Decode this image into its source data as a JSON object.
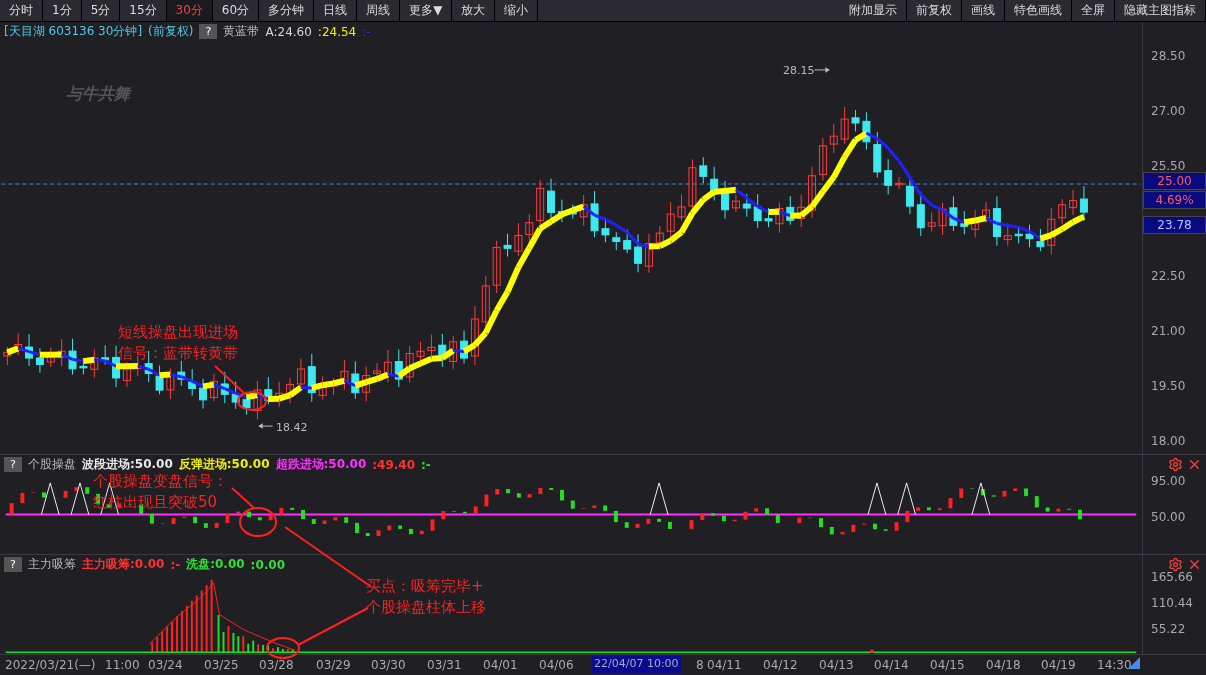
{
  "toolbar": {
    "left": [
      {
        "label": "分时",
        "selected": false
      },
      {
        "label": "1分",
        "selected": false
      },
      {
        "label": "5分",
        "selected": false
      },
      {
        "label": "15分",
        "selected": false
      },
      {
        "label": "30分",
        "selected": true
      },
      {
        "label": "60分",
        "selected": false
      },
      {
        "label": "多分钟",
        "selected": false
      },
      {
        "label": "日线",
        "selected": false
      },
      {
        "label": "周线",
        "selected": false
      },
      {
        "label": "更多▼",
        "selected": false
      },
      {
        "label": "放大",
        "selected": false
      },
      {
        "label": "缩小",
        "selected": false
      }
    ],
    "right": [
      "附加显示",
      "前复权",
      "画线",
      "特色画线",
      "全屏",
      "隐藏主图指标"
    ]
  },
  "main_header": {
    "title": "[天目湖 603136 30分钟]",
    "adjust": "(前复权)",
    "help": "?",
    "indicator": "黄蓝带",
    "values": [
      {
        "text": "A:24.60",
        "color": "#d8d8d8"
      },
      {
        "text": ":24.54",
        "color": "#f0f000"
      },
      {
        "text": ":-",
        "color": "#3030ff"
      }
    ]
  },
  "logo": "与牛共舞",
  "price_axis": {
    "ticks": [
      "28.50",
      "27.00",
      "25.50",
      "22.50",
      "21.00",
      "19.50",
      "18.00"
    ],
    "tags": [
      "25.00",
      "4.69%",
      "23.78"
    ]
  },
  "chart_marks": {
    "high": "28.15",
    "low": "18.42"
  },
  "callouts": [
    {
      "lines": [
        "短线操盘出现进场",
        "信号：蓝带转黄带"
      ]
    },
    {
      "lines": [
        "个股操盘变盘信号：",
        "红柱出现且突破50"
      ]
    },
    {
      "lines": [
        "买点：吸筹完毕+",
        "个股操盘柱体上移"
      ]
    }
  ],
  "indicators": [
    {
      "help": "?",
      "name": "个股操盘",
      "values": [
        {
          "text": "波段进场:50.00",
          "color": "#e8e8e8"
        },
        {
          "text": "反弹进场:50.00",
          "color": "#f0f000"
        },
        {
          "text": "超跌进场:50.00",
          "color": "#ff30ff"
        },
        {
          "text": ":49.40",
          "color": "#ff3030"
        },
        {
          "text": ":-",
          "color": "#30e030"
        }
      ],
      "axis": [
        "95.00",
        "50.00"
      ]
    },
    {
      "help": "?",
      "name": "主力吸筹",
      "values": [
        {
          "text": "主力吸筹:0.00",
          "color": "#ff3030"
        },
        {
          "text": ":-",
          "color": "#ff3030"
        },
        {
          "text": "洗盘:0.00",
          "color": "#30e030"
        },
        {
          "text": ":0.00",
          "color": "#30e030"
        }
      ],
      "axis": [
        "165.66",
        "110.44",
        "55.22"
      ]
    }
  ],
  "time_axis": {
    "labels": [
      "2022/03/21(—)",
      "11:00",
      "03/24",
      "03/25",
      "03/28",
      "03/29",
      "03/30",
      "03/31",
      "04/01",
      "04/06",
      "8",
      "04/11",
      "04/12",
      "04/13",
      "04/14",
      "04/15",
      "04/18",
      "04/19",
      "14:30"
    ],
    "cursor": "22/04/07 10:00"
  }
}
